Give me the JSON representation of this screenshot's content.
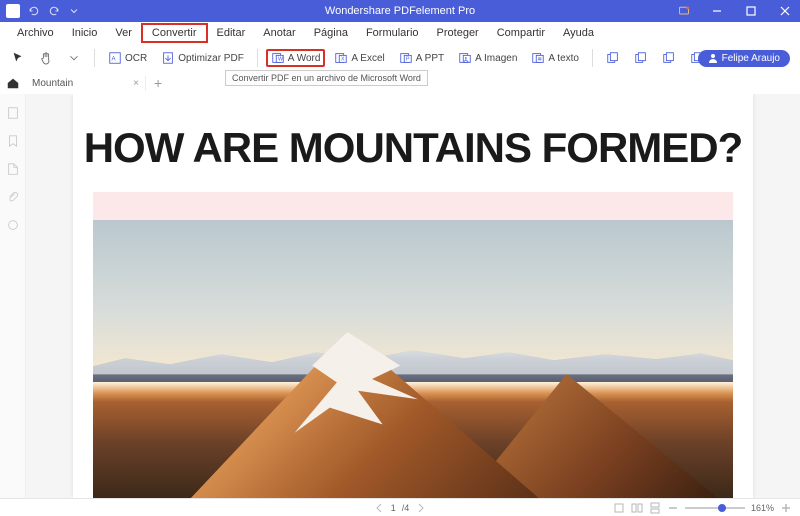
{
  "app": {
    "title": "Wondershare PDFelement Pro"
  },
  "menu": {
    "items": [
      "Archivo",
      "Inicio",
      "Ver",
      "Convertir",
      "Editar",
      "Anotar",
      "Página",
      "Formulario",
      "Proteger",
      "Compartir",
      "Ayuda"
    ],
    "highlighted": "Convertir"
  },
  "toolbar": {
    "ocr": "OCR",
    "optimize": "Optimizar PDF",
    "toWord": "A Word",
    "toExcel": "A Excel",
    "toPPT": "A PPT",
    "toImage": "A Imagen",
    "toText": "A texto"
  },
  "tooltip": "Convertir PDF en un archivo de Microsoft Word",
  "user": {
    "name": "Felipe Araujo"
  },
  "tabs": {
    "items": [
      {
        "name": "Mountain"
      }
    ]
  },
  "document": {
    "heading": "HOW ARE MOUNTAINS FORMED?"
  },
  "status": {
    "page": "1",
    "total": "/4",
    "zoom": "161%"
  }
}
